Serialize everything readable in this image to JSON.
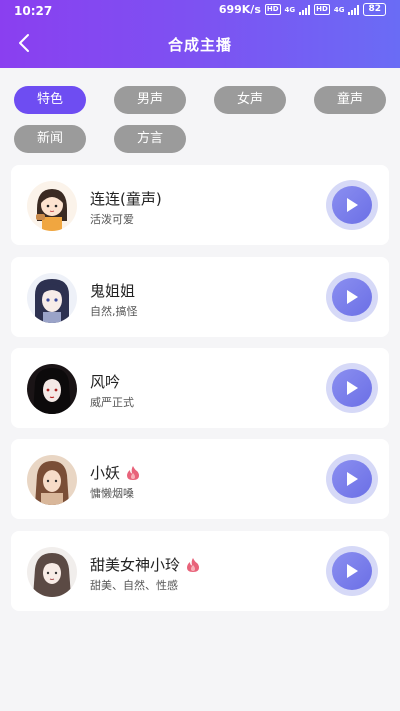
{
  "status_bar": {
    "time": "10:27",
    "speed": "699K/s",
    "network_1": "4G",
    "network_2": "4G",
    "battery": "82"
  },
  "header": {
    "title": "合成主播",
    "back_icon": "chevron-left-icon",
    "gradient_start": "#8a3ff0",
    "gradient_end": "#6a6cf5"
  },
  "tabs": [
    {
      "label": "特色",
      "active": true
    },
    {
      "label": "男声",
      "active": false
    },
    {
      "label": "女声",
      "active": false
    },
    {
      "label": "童声",
      "active": false
    },
    {
      "label": "新闻",
      "active": false
    },
    {
      "label": "方言",
      "active": false
    }
  ],
  "voices": [
    {
      "name": "连连(童声)",
      "desc": "活泼可爱",
      "hot": false,
      "avatar_icon": "cartoon-girl-avatar"
    },
    {
      "name": "鬼姐姐",
      "desc": "自然,搞怪",
      "hot": false,
      "avatar_icon": "anime-girl-avatar"
    },
    {
      "name": "风吟",
      "desc": "威严正式",
      "hot": false,
      "avatar_icon": "dark-hair-avatar"
    },
    {
      "name": "小妖",
      "desc": "慵懒烟嗓",
      "hot": true,
      "avatar_icon": "portrait-avatar"
    },
    {
      "name": "甜美女神小玲",
      "desc": "甜美、自然、性感",
      "hot": true,
      "avatar_icon": "sketch-girl-avatar"
    }
  ],
  "colors": {
    "accent": "#6e4df2",
    "tab_inactive": "#9b9b9b",
    "play_ring": "#d6d9f7",
    "hot_icon": "#e8637a"
  }
}
